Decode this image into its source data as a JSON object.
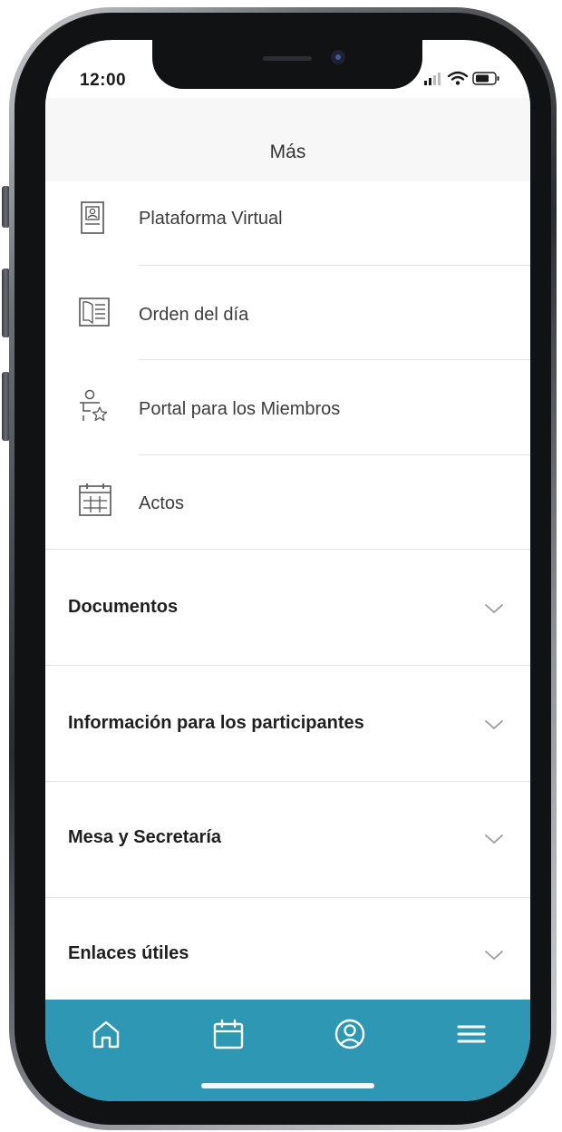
{
  "status_bar": {
    "time": "12:00"
  },
  "header": {
    "title": "Más"
  },
  "menu_items": [
    {
      "label": "Plataforma Virtual",
      "icon": "id-badge-icon"
    },
    {
      "label": "Orden del día",
      "icon": "document-icon"
    },
    {
      "label": "Portal para los Miembros",
      "icon": "member-star-icon"
    },
    {
      "label": "Actos",
      "icon": "calendar-grid-icon"
    }
  ],
  "sections": [
    {
      "label": "Documentos",
      "icon": "chevron-down-icon"
    },
    {
      "label": "Información para los participantes",
      "icon": "chevron-down-icon"
    },
    {
      "label": "Mesa y Secretaría",
      "icon": "chevron-down-icon"
    },
    {
      "label": "Enlaces útiles",
      "icon": "chevron-down-icon"
    }
  ],
  "bottom_nav": [
    {
      "name": "home",
      "icon": "home-icon"
    },
    {
      "name": "calendar",
      "icon": "calendar-icon"
    },
    {
      "name": "profile",
      "icon": "user-circle-icon"
    },
    {
      "name": "menu",
      "icon": "hamburger-menu-icon"
    }
  ],
  "colors": {
    "nav_background": "#2e97b3",
    "header_background": "#f7f7f7",
    "text": "#3c3c3c"
  }
}
